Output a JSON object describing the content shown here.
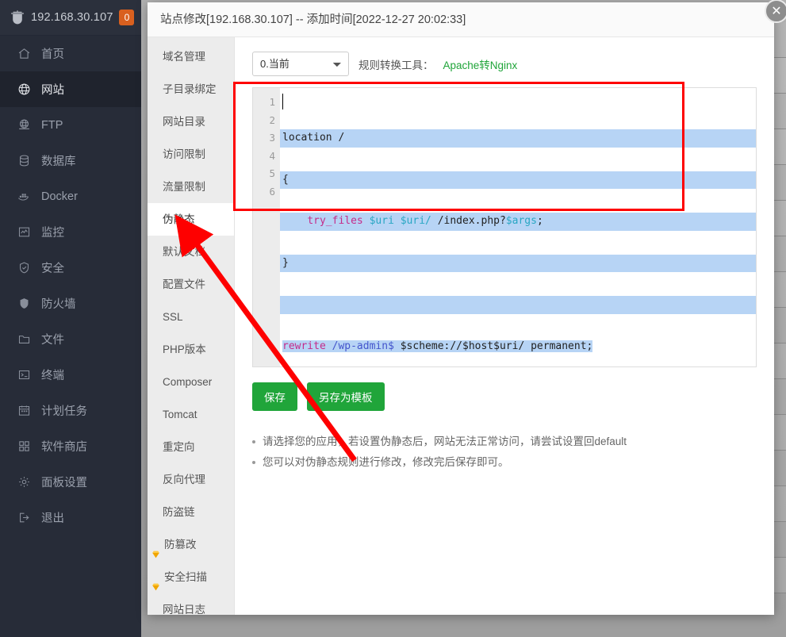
{
  "sidebar": {
    "header": {
      "ip": "192.168.30.107",
      "badge": "0",
      "logo_icon": "pagoda-shield-icon"
    },
    "items": [
      {
        "label": "首页",
        "icon": "home-icon",
        "active": false
      },
      {
        "label": "网站",
        "icon": "globe-icon",
        "active": true
      },
      {
        "label": "FTP",
        "icon": "ftp-globe-icon",
        "active": false
      },
      {
        "label": "数据库",
        "icon": "database-icon",
        "active": false
      },
      {
        "label": "Docker",
        "icon": "docker-icon",
        "active": false
      },
      {
        "label": "监控",
        "icon": "monitor-chart-icon",
        "active": false
      },
      {
        "label": "安全",
        "icon": "shield-check-icon",
        "active": false
      },
      {
        "label": "防火墙",
        "icon": "shield-solid-icon",
        "active": false
      },
      {
        "label": "文件",
        "icon": "folder-icon",
        "active": false
      },
      {
        "label": "终端",
        "icon": "terminal-icon",
        "active": false
      },
      {
        "label": "计划任务",
        "icon": "calendar-icon",
        "active": false
      },
      {
        "label": "软件商店",
        "icon": "grid-apps-icon",
        "active": false
      },
      {
        "label": "面板设置",
        "icon": "gear-icon",
        "active": false
      },
      {
        "label": "退出",
        "icon": "logout-icon",
        "active": false
      }
    ]
  },
  "modal": {
    "title": "站点修改[192.168.30.107] -- 添加时间[2022-12-27 20:02:33]",
    "close_icon": "close-icon",
    "menu": [
      {
        "label": "域名管理",
        "active": false,
        "gem": false
      },
      {
        "label": "子目录绑定",
        "active": false,
        "gem": false
      },
      {
        "label": "网站目录",
        "active": false,
        "gem": false
      },
      {
        "label": "访问限制",
        "active": false,
        "gem": false
      },
      {
        "label": "流量限制",
        "active": false,
        "gem": false
      },
      {
        "label": "伪静态",
        "active": true,
        "gem": false
      },
      {
        "label": "默认文档",
        "active": false,
        "gem": false
      },
      {
        "label": "配置文件",
        "active": false,
        "gem": false
      },
      {
        "label": "SSL",
        "active": false,
        "gem": false
      },
      {
        "label": "PHP版本",
        "active": false,
        "gem": false
      },
      {
        "label": "Composer",
        "active": false,
        "gem": false
      },
      {
        "label": "Tomcat",
        "active": false,
        "gem": false
      },
      {
        "label": "重定向",
        "active": false,
        "gem": false
      },
      {
        "label": "反向代理",
        "active": false,
        "gem": false
      },
      {
        "label": "防盗链",
        "active": false,
        "gem": false
      },
      {
        "label": "防篡改",
        "active": false,
        "gem": true
      },
      {
        "label": "安全扫描",
        "active": false,
        "gem": true
      },
      {
        "label": "网站日志",
        "active": false,
        "gem": false
      }
    ],
    "toolbar": {
      "select_value": "0.当前",
      "select_options": [
        "0.当前"
      ],
      "convert_label": "规则转换工具：",
      "convert_link": "Apache转Nginx",
      "link_color": "#20a53a"
    },
    "editor": {
      "line_numbers": [
        "1",
        "2",
        "3",
        "4",
        "5",
        "6"
      ],
      "lines": [
        "location /",
        "{",
        "    try_files $uri $uri/ /index.php?$args;",
        "}",
        "",
        "rewrite /wp-admin$ $scheme://$host$uri/ permanent;"
      ],
      "selection_color": "#b7d4f5"
    },
    "buttons": {
      "save": "保存",
      "save_as_template": "另存为模板",
      "color": "#20a53a"
    },
    "tips": [
      "请选择您的应用，若设置伪静态后，网站无法正常访问，请尝试设置回default",
      "您可以对伪静态规则进行修改，修改完后保存即可。"
    ]
  },
  "annotations": {
    "box_color": "#fe0000",
    "arrow_color": "#fe0000"
  }
}
